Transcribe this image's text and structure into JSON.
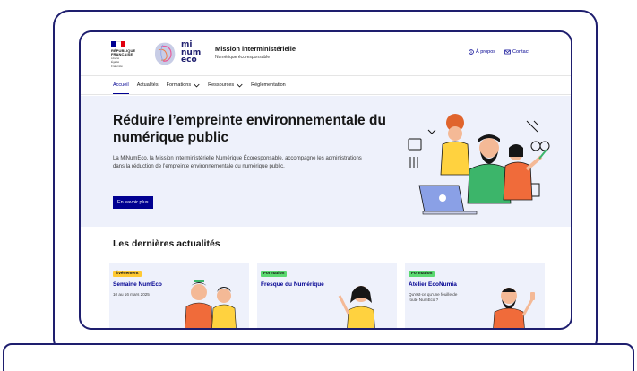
{
  "header": {
    "republique": [
      "RÉPUBLIQUE",
      "FRANÇAISE"
    ],
    "motto": [
      "Liberté",
      "Égalité",
      "Fraternité"
    ],
    "logo_lines": [
      "mi",
      "num_",
      "eco"
    ],
    "site_title": "Mission interministérielle",
    "site_subtitle": "Numérique écoresponsable",
    "tools": [
      {
        "label": "À propos",
        "icon": "info-circle-icon"
      },
      {
        "label": "Contact",
        "icon": "mail-icon"
      }
    ]
  },
  "nav": {
    "items": [
      {
        "label": "Accueil",
        "active": true,
        "dropdown": false
      },
      {
        "label": "Actualités",
        "active": false,
        "dropdown": false
      },
      {
        "label": "Formations",
        "active": false,
        "dropdown": true
      },
      {
        "label": "Ressources",
        "active": false,
        "dropdown": true
      },
      {
        "label": "Réglementation",
        "active": false,
        "dropdown": false
      }
    ]
  },
  "hero": {
    "title": "Réduire l’empreinte environnementale du numérique public",
    "text": "La MiNumEco, la Mission Interministérielle Numérique Écoresponsable, accompagne les administrations dans la réduction de l’empreinte environnementale du numérique public.",
    "button_label": "En savoir plus"
  },
  "news": {
    "title": "Les dernières actualités",
    "cards": [
      {
        "badge": "Événement",
        "badge_color": "#ffc933",
        "title": "Semaine NumEco",
        "subtitle": "10 au 16 mars 2025"
      },
      {
        "badge": "Formation",
        "badge_color": "#5ad970",
        "title": "Fresque du Numérique",
        "subtitle": ""
      },
      {
        "badge": "Formation",
        "badge_color": "#5ad970",
        "title": "Atelier EcoNumia",
        "subtitle": "Qu’est-ce qu’une feuille de route NumEco ?"
      }
    ]
  },
  "colors": {
    "primary": "#000091",
    "frame": "#1e1e6e",
    "hero_bg": "#eef1fb"
  }
}
